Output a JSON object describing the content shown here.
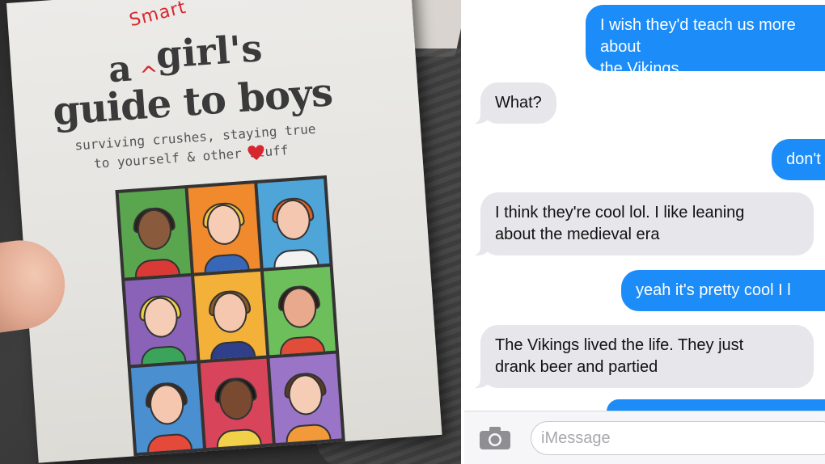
{
  "book": {
    "title_a": "a",
    "title_smart": "Smart",
    "title_caret": "^",
    "title_girls": "girl's",
    "title_guide": "guide to boys",
    "subtitle_line1": "surviving crushes, staying true",
    "subtitle_line2": "to yourself & other   stuff"
  },
  "chat": {
    "messages": [
      {
        "side": "sent",
        "text": "I wish they'd teach us more about\nthe Vikings."
      },
      {
        "side": "received",
        "text": "What?"
      },
      {
        "side": "sent",
        "text": "don't"
      },
      {
        "side": "received",
        "text": "I think they're cool lol. I like leaning\nabout the medieval era"
      },
      {
        "side": "sent",
        "text": "yeah it's pretty cool I l"
      },
      {
        "side": "received",
        "text": "The Vikings lived the life. They just\ndrank beer and partied"
      }
    ],
    "input_placeholder": "iMessage"
  },
  "colors": {
    "sent_bubble": "#1b8cf8",
    "received_bubble": "#e6e6eb",
    "accent_red": "#d8262f"
  },
  "icons": {
    "camera": "camera-icon"
  }
}
